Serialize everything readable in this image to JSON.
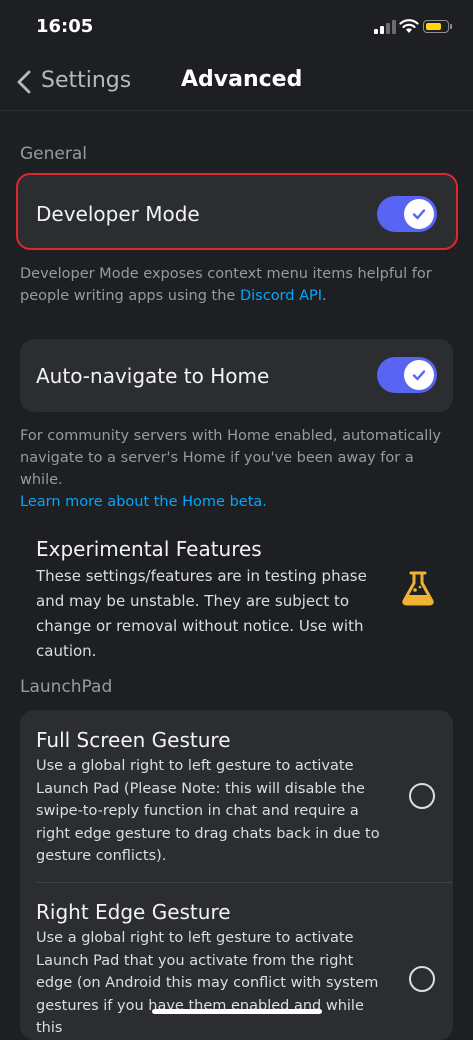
{
  "status_bar": {
    "time": "16:05",
    "signal_icon": "cellular-signal-icon",
    "wifi_icon": "wifi-icon",
    "battery_icon": "battery-icon",
    "battery_color": "#ffd60a"
  },
  "header": {
    "back_label": "Settings",
    "title": "Advanced"
  },
  "general": {
    "section_label": "General",
    "developer_mode": {
      "label": "Developer Mode",
      "enabled": true,
      "help_prefix": "Developer Mode exposes context menu items helpful for people writing apps using the ",
      "help_link": "Discord API",
      "help_suffix": "."
    },
    "auto_navigate": {
      "label": "Auto-navigate to Home",
      "enabled": true,
      "help": "For community servers with Home enabled, automatically navigate to a server's Home if you've been away for a while.",
      "help_link": "Learn more about the Home beta."
    },
    "experimental": {
      "title": "Experimental Features",
      "description": "These settings/features are in testing phase and may be unstable. They are subject to change or removal without notice. Use with caution.",
      "icon": "flask-icon"
    }
  },
  "launchpad": {
    "section_label": "LaunchPad",
    "options": [
      {
        "title": "Full Screen Gesture",
        "description": "Use a global right to left gesture to activate Launch Pad (Please Note: this will disable the swipe-to-reply function in chat and require a right edge gesture to drag chats back in due to gesture conflicts).",
        "selected": false
      },
      {
        "title": "Right Edge Gesture",
        "description": "Use a global right to left gesture to activate Launch Pad that you activate from the right edge (on Android this may conflict with system gestures if you have them enabled and while this",
        "selected": false
      }
    ]
  },
  "colors": {
    "background": "#1e1f22",
    "card": "#2b2d31",
    "accent": "#5865f2",
    "link": "#00a8fc",
    "highlight_border": "#e0262f"
  }
}
